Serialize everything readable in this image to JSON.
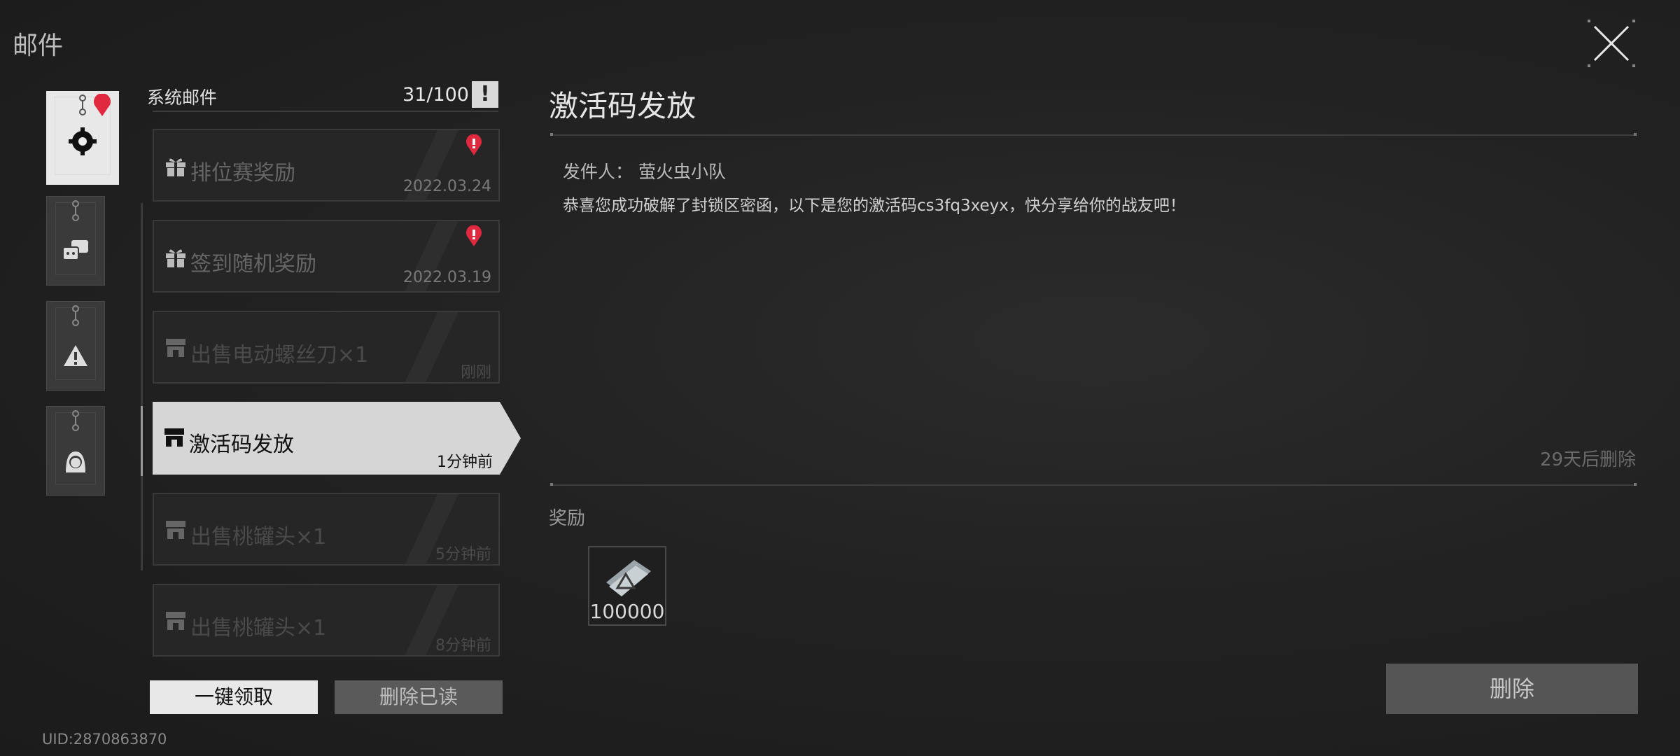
{
  "header": {
    "title": "邮件"
  },
  "categories": [
    {
      "name": "system",
      "icon": "gear-icon",
      "unread": true
    },
    {
      "name": "friends",
      "icon": "chat-icon",
      "unread": false
    },
    {
      "name": "warning",
      "icon": "warning-icon",
      "unread": false
    },
    {
      "name": "personal",
      "icon": "person-icon",
      "unread": false
    }
  ],
  "list": {
    "title": "系统邮件",
    "count": "31/100",
    "info_glyph": "!",
    "items": [
      {
        "title": "排位赛奖励",
        "time": "2022.03.24",
        "icon": "gift-icon",
        "unread": true
      },
      {
        "title": "签到随机奖励",
        "time": "2022.03.19",
        "icon": "gift-icon",
        "unread": true
      },
      {
        "title": "出售电动螺丝刀×1",
        "time": "刚刚",
        "icon": "shop-icon",
        "unread": false
      },
      {
        "title": "激活码发放",
        "time": "1分钟前",
        "icon": "shop-icon",
        "unread": false,
        "selected": true
      },
      {
        "title": "出售桃罐头×1",
        "time": "5分钟前",
        "icon": "shop-icon",
        "unread": false
      },
      {
        "title": "出售桃罐头×1",
        "time": "8分钟前",
        "icon": "shop-icon",
        "unread": false
      }
    ],
    "claim_all_label": "一键领取",
    "delete_read_label": "删除已读"
  },
  "uid": "UID:2870863870",
  "detail": {
    "title": "激活码发放",
    "sender_label": "发件人：",
    "sender_name": "萤火虫小队",
    "body": "恭喜您成功破解了封锁区密函，以下是您的激活码cs3fq3xeyx，快分享给你的战友吧！",
    "expire": "29天后删除",
    "reward_label": "奖励",
    "reward_qty": "100000",
    "delete_label": "删除"
  },
  "colors": {
    "unread_dot": "#e0293f",
    "selected_bg": "#d6d6d6"
  }
}
